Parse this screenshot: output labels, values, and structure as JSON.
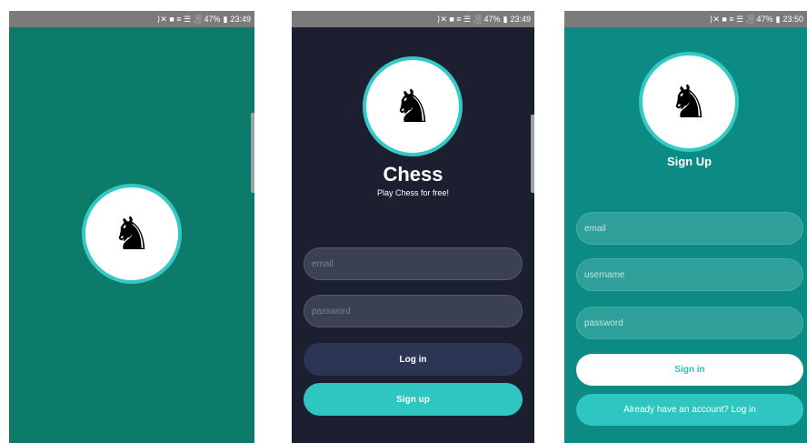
{
  "status_bar": {
    "screen1": {
      "icons": "⟩✕ ■ ≡ ☰ .░",
      "battery": "47%",
      "time": "23:49"
    },
    "screen2": {
      "icons": "⟩✕ ■ ≡ ☰ .░",
      "battery": "47%",
      "time": "23:49"
    },
    "screen3": {
      "icons": "⟩✕ ■ ≡ ☰ .░",
      "battery": "47%",
      "time": "23:50"
    }
  },
  "logo": {
    "glyph": "♞",
    "icon": "chess-knight-icon"
  },
  "login": {
    "title": "Chess",
    "subtitle": "Play Chess for free!",
    "email_placeholder": "email",
    "password_placeholder": "password",
    "login_button": "Log in",
    "signup_button": "Sign up"
  },
  "signup": {
    "title": "Sign Up",
    "email_placeholder": "email",
    "username_placeholder": "username",
    "password_placeholder": "password",
    "signin_button": "Sign in",
    "login_link": "Already have an account? Log in"
  },
  "colors": {
    "splash_bg": "#0d7b6a",
    "login_bg": "#1b1f2f",
    "signup_bg": "#0c8b85",
    "accent": "#34c9c4",
    "login_button_bg": "#2c3654"
  }
}
